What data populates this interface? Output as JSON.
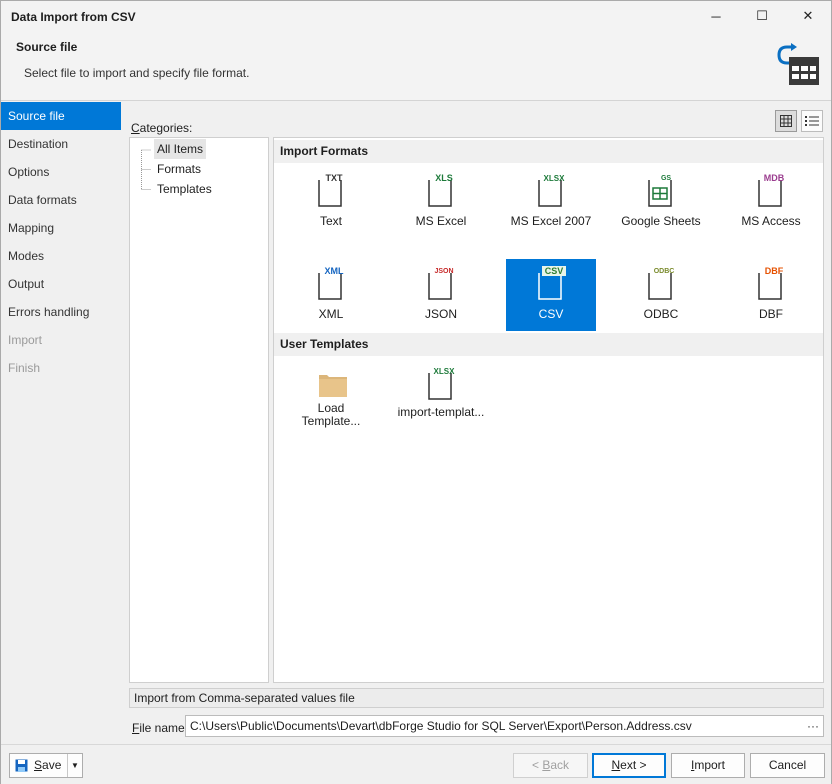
{
  "window": {
    "title": "Data Import from CSV",
    "minimize": "─",
    "maximize": "☐",
    "close": "✕"
  },
  "header": {
    "title": "Source file",
    "subtitle": "Select file to import and specify file format."
  },
  "nav": {
    "items": [
      {
        "label": "Source file",
        "state": "active"
      },
      {
        "label": "Destination",
        "state": "normal"
      },
      {
        "label": "Options",
        "state": "normal"
      },
      {
        "label": "Data formats",
        "state": "normal"
      },
      {
        "label": "Mapping",
        "state": "normal"
      },
      {
        "label": "Modes",
        "state": "normal"
      },
      {
        "label": "Output",
        "state": "normal"
      },
      {
        "label": "Errors handling",
        "state": "normal"
      },
      {
        "label": "Import",
        "state": "disabled"
      },
      {
        "label": "Finish",
        "state": "disabled"
      }
    ]
  },
  "categories": {
    "label_underlined": "C",
    "label_rest": "ategories:",
    "items": [
      "All Items",
      "Formats",
      "Templates"
    ],
    "selected": "All Items"
  },
  "view_modes": {
    "large_icons": "large-icons-view",
    "list": "list-view"
  },
  "gallery": {
    "import_formats_title": "Import Formats",
    "formats": [
      {
        "name": "Text",
        "tag": "TXT",
        "color": "#333333"
      },
      {
        "name": "MS Excel",
        "tag": "XLS",
        "color": "#1d7a3a"
      },
      {
        "name": "MS Excel 2007",
        "tag": "XLSX",
        "color": "#1d7a3a"
      },
      {
        "name": "Google Sheets",
        "tag": "GS",
        "color": "#1d7a3a"
      },
      {
        "name": "MS Access",
        "tag": "MDB",
        "color": "#9b3d8f"
      },
      {
        "name": "XML",
        "tag": "XML",
        "color": "#1565c0"
      },
      {
        "name": "JSON",
        "tag": "JSON",
        "color": "#c62828"
      },
      {
        "name": "CSV",
        "tag": "CSV",
        "color": "#2e7d32"
      },
      {
        "name": "ODBC",
        "tag": "ODBC",
        "color": "#7a8b2c"
      },
      {
        "name": "DBF",
        "tag": "DBF",
        "color": "#e65100"
      }
    ],
    "selected": "CSV",
    "user_templates_title": "User Templates",
    "templates": [
      {
        "name_line1": "Load",
        "name_line2": "Template...",
        "icon": "folder-icon"
      },
      {
        "name_line1": "import-templat...",
        "name_line2": "",
        "tag": "XLSX",
        "color": "#1d7a3a"
      }
    ]
  },
  "status": {
    "text": "Import from Comma-separated values file"
  },
  "file_name": {
    "label_underlined": "F",
    "label_rest": "ile name:",
    "value": "C:\\Users\\Public\\Documents\\Devart\\dbForge Studio for SQL Server\\Export\\Person.Address.csv",
    "browse": "···"
  },
  "footer": {
    "save_underlined": "S",
    "save_rest": "ave",
    "back_prefix": "< ",
    "back_underlined": "B",
    "back_rest": "ack",
    "next_underlined": "N",
    "next_rest": "ext >",
    "import_underlined": "I",
    "import_rest": "mport",
    "cancel": "Cancel"
  },
  "colors": {
    "accent": "#0078d7"
  }
}
